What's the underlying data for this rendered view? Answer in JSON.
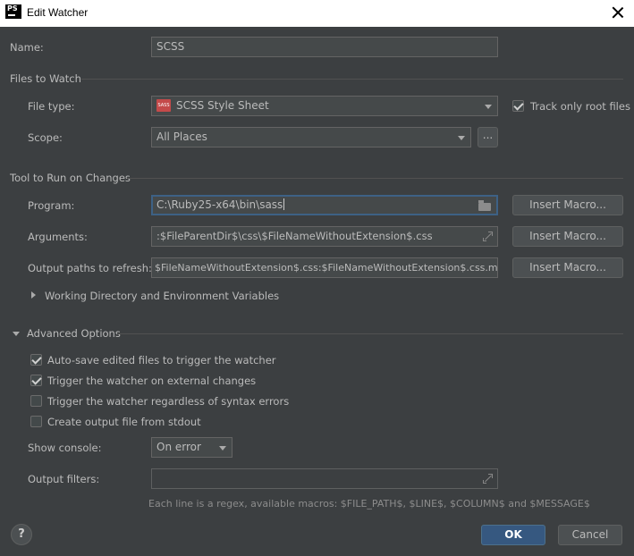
{
  "window": {
    "title": "Edit Watcher",
    "app_icon_text": "PS"
  },
  "name": {
    "label": "Name:",
    "value": "SCSS"
  },
  "files_to_watch": {
    "heading": "Files to Watch",
    "file_type_label": "File type:",
    "file_type_value": "SCSS Style Sheet",
    "file_type_icon_text": "SASS",
    "track_root_label": "Track only root files",
    "track_root_checked": true,
    "scope_label": "Scope:",
    "scope_value": "All Places",
    "scope_browse": "..."
  },
  "tool": {
    "heading": "Tool to Run on Changes",
    "program_label": "Program:",
    "program_value": "C:\\Ruby25-x64\\bin\\sass",
    "arguments_label": "Arguments:",
    "arguments_value": ":$FileParentDir$\\css\\$FileNameWithoutExtension$.css",
    "output_paths_label": "Output paths to refresh:",
    "output_paths_value": "$FileNameWithoutExtension$.css:$FileNameWithoutExtension$.css.map",
    "insert_macro": "Insert Macro...",
    "working_dir_label": "Working Directory and Environment Variables"
  },
  "advanced": {
    "heading": "Advanced Options",
    "options": [
      {
        "label": "Auto-save edited files to trigger the watcher",
        "checked": true
      },
      {
        "label": "Trigger the watcher on external changes",
        "checked": true
      },
      {
        "label": "Trigger the watcher regardless of syntax errors",
        "checked": false
      },
      {
        "label": "Create output file from stdout",
        "checked": false
      }
    ],
    "show_console_label": "Show console:",
    "show_console_value": "On error",
    "output_filters_label": "Output filters:",
    "output_filters_value": "",
    "hint": "Each line is a regex, available macros: $FILE_PATH$, $LINE$, $COLUMN$ and $MESSAGE$"
  },
  "footer": {
    "help": "?",
    "ok": "OK",
    "cancel": "Cancel"
  },
  "colors": {
    "background": "#3c3f41",
    "field": "#45494a",
    "accent": "#365880",
    "focus": "#3d6185"
  }
}
